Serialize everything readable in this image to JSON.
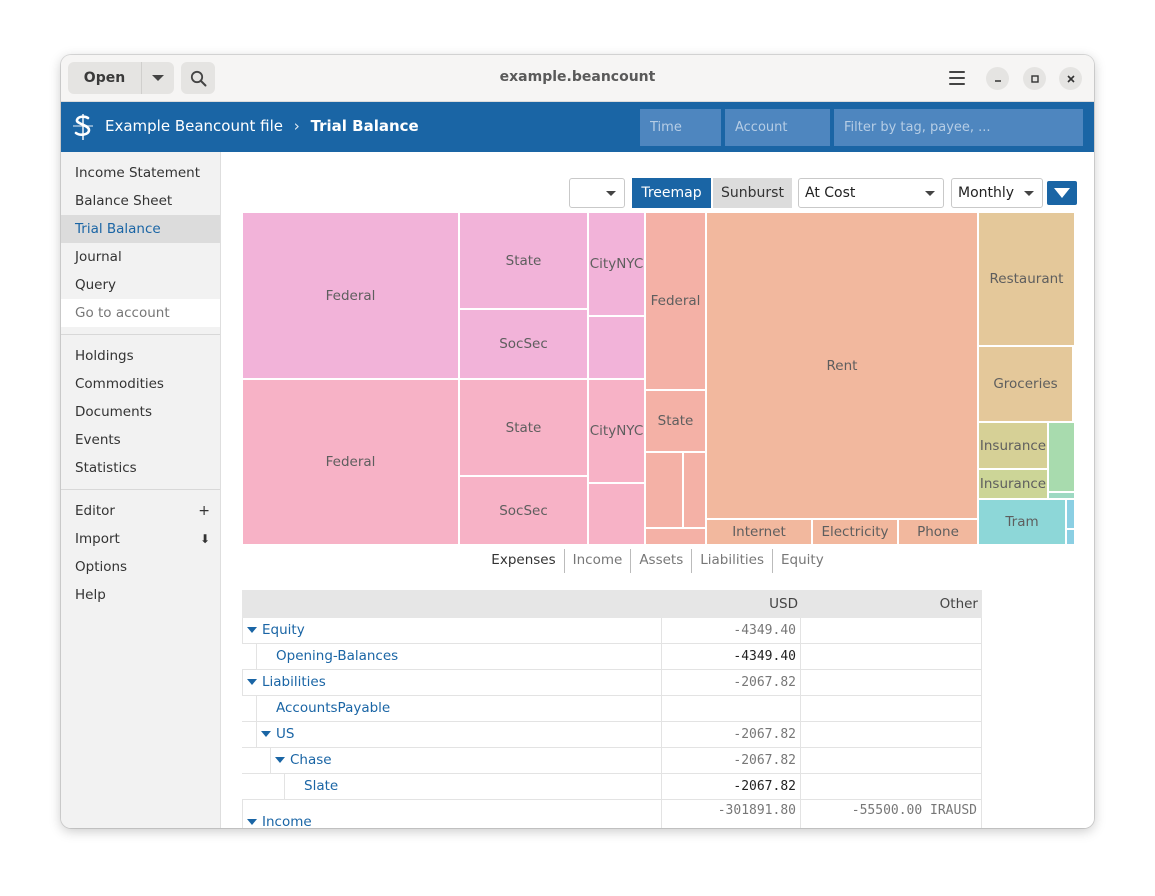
{
  "window": {
    "title": "example.beancount",
    "open_label": "Open"
  },
  "header": {
    "file_title": "Example Beancount file",
    "separator": "›",
    "page": "Trial Balance",
    "time_placeholder": "Time",
    "account_placeholder": "Account",
    "filter_placeholder": "Filter by tag, payee, ..."
  },
  "sidebar": {
    "reports": [
      "Income Statement",
      "Balance Sheet",
      "Trial Balance",
      "Journal",
      "Query"
    ],
    "goto": "Go to account",
    "views": [
      "Holdings",
      "Commodities",
      "Documents",
      "Events",
      "Statistics"
    ],
    "tools": [
      "Editor",
      "Import",
      "Options",
      "Help"
    ],
    "active": "Trial Balance"
  },
  "controls": {
    "treemap": "Treemap",
    "sunburst": "Sunburst",
    "conversion": "At Cost",
    "interval": "Monthly",
    "accent": "#1a65a5"
  },
  "treemap": {
    "labels": {
      "federal_a": "Federal",
      "state_a": "State",
      "citynyc_a": "CityNYC",
      "socsec_a": "SocSec",
      "federal_b": "Federal",
      "state_b": "State",
      "citynyc_b": "CityNYC",
      "socsec_b": "SocSec",
      "federal_c": "Federal",
      "state_c": "State",
      "rent": "Rent",
      "internet": "Internet",
      "electricity": "Electricity",
      "phone": "Phone",
      "restaurant": "Restaurant",
      "groceries": "Groceries",
      "insurance_a": "Insurance",
      "insurance_b": "Insurance",
      "tram": "Tram"
    }
  },
  "chart_tabs": [
    "Expenses",
    "Income",
    "Assets",
    "Liabilities",
    "Equity"
  ],
  "table": {
    "col_usd": "USD",
    "col_other": "Other",
    "rows": [
      {
        "name": "Equity",
        "usd": "-4349.40",
        "other": ""
      },
      {
        "name": "Opening-Balances",
        "usd": "-4349.40",
        "other": ""
      },
      {
        "name": "Liabilities",
        "usd": "-2067.82",
        "other": ""
      },
      {
        "name": "AccountsPayable",
        "usd": "",
        "other": ""
      },
      {
        "name": "US",
        "usd": "-2067.82",
        "other": ""
      },
      {
        "name": "Chase",
        "usd": "-2067.82",
        "other": ""
      },
      {
        "name": "Slate",
        "usd": "-2067.82",
        "other": ""
      },
      {
        "name": "Income",
        "usd": "-301891.80",
        "other": "-55500.00 IRAUSD"
      }
    ]
  }
}
